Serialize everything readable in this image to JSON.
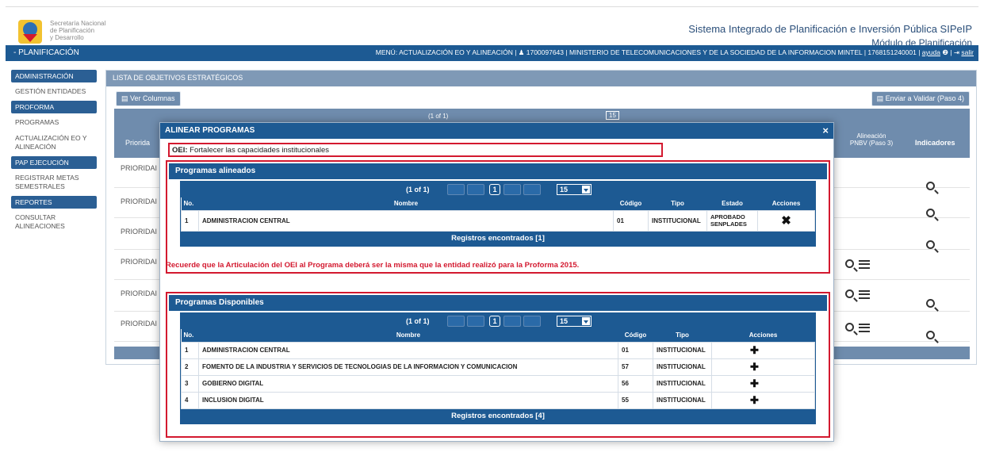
{
  "header": {
    "logo_lines": [
      "Secretaría Nacional",
      "de Planificación",
      "y Desarrollo"
    ],
    "system_title": "Sistema Integrado de Planificación e Inversión Pública SIPeIP",
    "module": "Módulo de Planificación"
  },
  "topbar": {
    "section": "- PLANIFICACIÓN",
    "info": "MENÚ: ACTUALIZACIÓN EO Y ALINEACIÓN | ♟ 1700097643 | MINISTERIO DE TELECOMUNICACIONES Y DE LA SOCIEDAD DE LA INFORMACION MINTEL | 1768151240001 |",
    "help": "ayuda",
    "exit": "salir"
  },
  "sidebar": {
    "sections": [
      {
        "head": "ADMINISTRACIÓN",
        "items": [
          "GESTIÓN ENTIDADES"
        ]
      },
      {
        "head": "PROFORMA",
        "items": [
          "PROGRAMAS",
          "ACTUALIZACIÓN EO Y ALINEACIÓN"
        ]
      },
      {
        "head": "PAP EJECUCIÓN",
        "items": [
          "REGISTRAR METAS SEMESTRALES"
        ]
      },
      {
        "head": "REPORTES",
        "items": [
          "CONSULTAR ALINEACIONES"
        ]
      }
    ]
  },
  "main": {
    "title": "LISTA DE OBJETIVOS ESTRATÉGICOS",
    "ver_columnas": "Ver Columnas",
    "enviar": "Enviar a Validar (Paso 4)",
    "pager_count": "(1 of 1)",
    "pager_size": "15",
    "col_priority": "Priorida",
    "col_alineacion": "Alineación PNBV (Paso 3)",
    "col_indicadores": "Indicadores",
    "rows": [
      "PRIORIDAI",
      "PRIORIDAI",
      "PRIORIDAI",
      "PRIORIDAI",
      "PRIORIDAI",
      "PRIORIDAI"
    ]
  },
  "modal": {
    "title": "ALINEAR PROGRAMAS",
    "close": "×",
    "oei_label": "OEI:",
    "oei_text": "Fortalecer las capacidades institucionales",
    "aligned": {
      "title": "Programas alineados",
      "pager_count": "(1 of 1)",
      "page": "1",
      "size": "15",
      "headers": {
        "no": "No.",
        "nombre": "Nombre",
        "codigo": "Código",
        "tipo": "Tipo",
        "estado": "Estado",
        "acciones": "Acciones"
      },
      "rows": [
        {
          "no": "1",
          "nombre": "ADMINISTRACION CENTRAL",
          "codigo": "01",
          "tipo": "INSTITUCIONAL",
          "estado": "APROBADO SENPLADES"
        }
      ],
      "footer": "Registros encontrados [1]"
    },
    "warning": "Recuerde que la Articulación del OEI al Programa deberá ser la misma que la entidad realizó para la Proforma 2015.",
    "available": {
      "title": "Programas Disponibles",
      "pager_count": "(1 of 1)",
      "page": "1",
      "size": "15",
      "headers": {
        "no": "No.",
        "nombre": "Nombre",
        "codigo": "Código",
        "tipo": "Tipo",
        "acciones": "Acciones"
      },
      "rows": [
        {
          "no": "1",
          "nombre": "ADMINISTRACION CENTRAL",
          "codigo": "01",
          "tipo": "INSTITUCIONAL"
        },
        {
          "no": "2",
          "nombre": "FOMENTO DE LA INDUSTRIA Y SERVICIOS DE TECNOLOGIAS DE LA INFORMACION Y COMUNICACION",
          "codigo": "57",
          "tipo": "INSTITUCIONAL"
        },
        {
          "no": "3",
          "nombre": "GOBIERNO DIGITAL",
          "codigo": "56",
          "tipo": "INSTITUCIONAL"
        },
        {
          "no": "4",
          "nombre": "INCLUSION DIGITAL",
          "codigo": "55",
          "tipo": "INSTITUCIONAL"
        }
      ],
      "footer": "Registros encontrados [4]"
    }
  },
  "colors": {
    "primary": "#1d5a93",
    "secondary": "#6f8cad",
    "highlight": "#d3192f"
  }
}
